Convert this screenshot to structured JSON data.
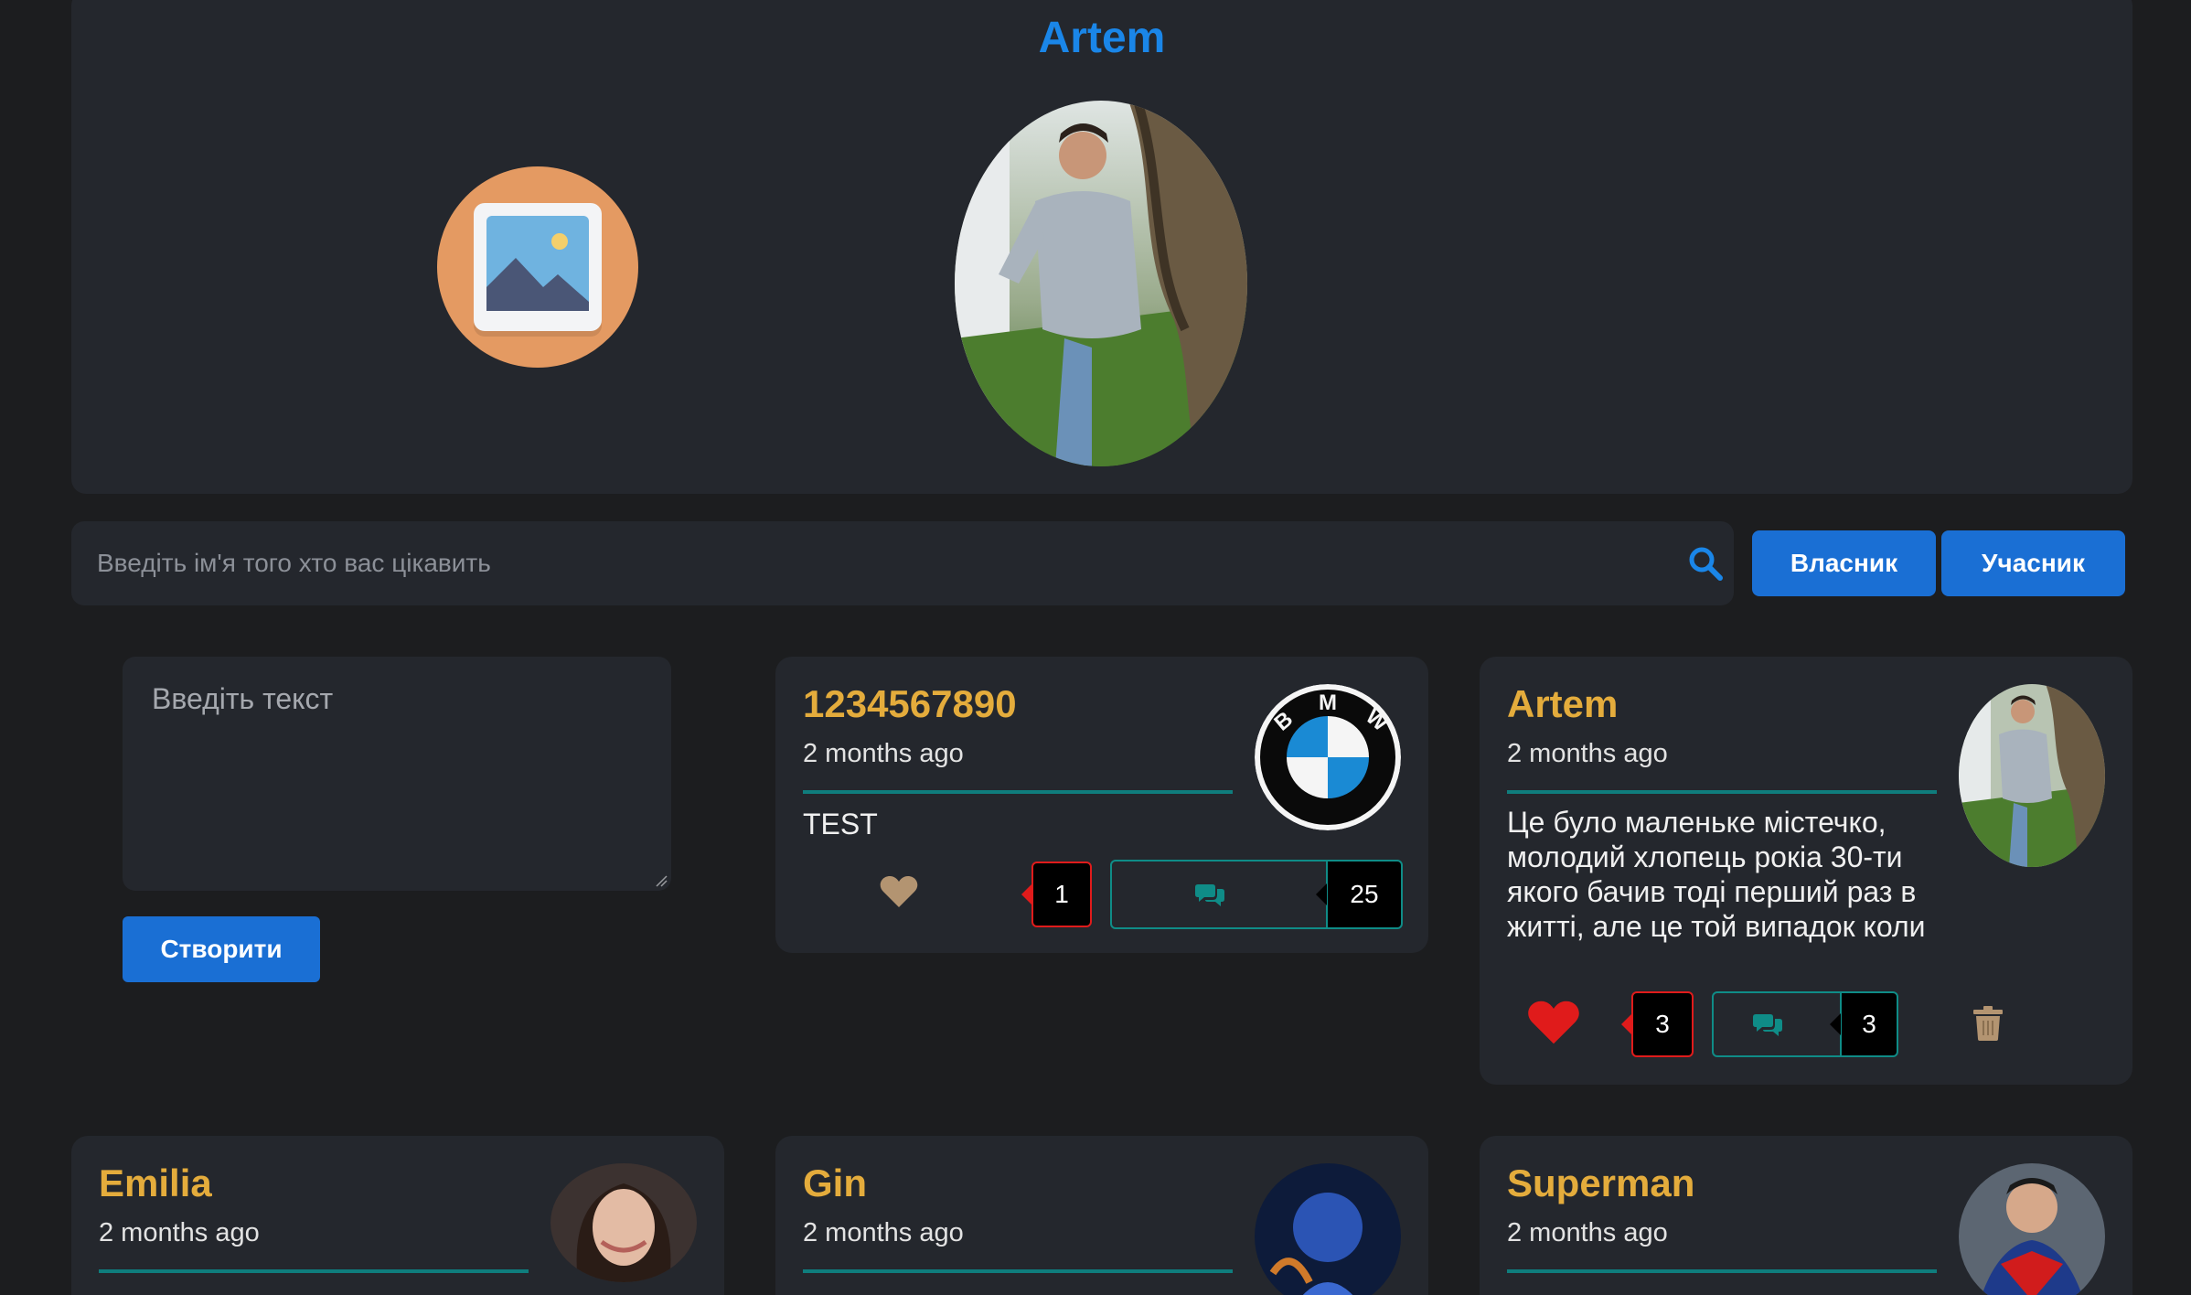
{
  "profile": {
    "name": "Artem"
  },
  "search": {
    "placeholder": "Введіть ім'я того хто вас цікавить"
  },
  "role_buttons": {
    "owner": "Власник",
    "member": "Учасник"
  },
  "compose": {
    "placeholder": "Введіть текст",
    "submit_label": "Створити"
  },
  "posts": [
    {
      "author": "1234567890",
      "time": "2 months ago",
      "text": "TEST",
      "likes": "1",
      "comments": "25",
      "avatar": "bmw-logo",
      "liked": false
    },
    {
      "author": "Artem",
      "time": "2 months ago",
      "text": "Це було маленьке містечко, молодий хлопець рокіа 30-ти якого бачив тоді перший раз в житті, але це той випадок коли ти з пешого погляду",
      "likes": "3",
      "comments": "3",
      "avatar": "user-photo",
      "liked": true,
      "deletable": true
    },
    {
      "author": "Emilia",
      "time": "2 months ago",
      "avatar": "user-photo"
    },
    {
      "author": "Gin",
      "time": "2 months ago",
      "avatar": "user-photo"
    },
    {
      "author": "Superman",
      "time": "2 months ago",
      "avatar": "user-photo"
    }
  ],
  "colors": {
    "background": "#1c1d1f",
    "card": "#24272d",
    "accent_blue": "#1a6fd4",
    "author_gold": "#e4ac3c",
    "teal": "#0f8c87",
    "like_red": "#e01b1b"
  }
}
